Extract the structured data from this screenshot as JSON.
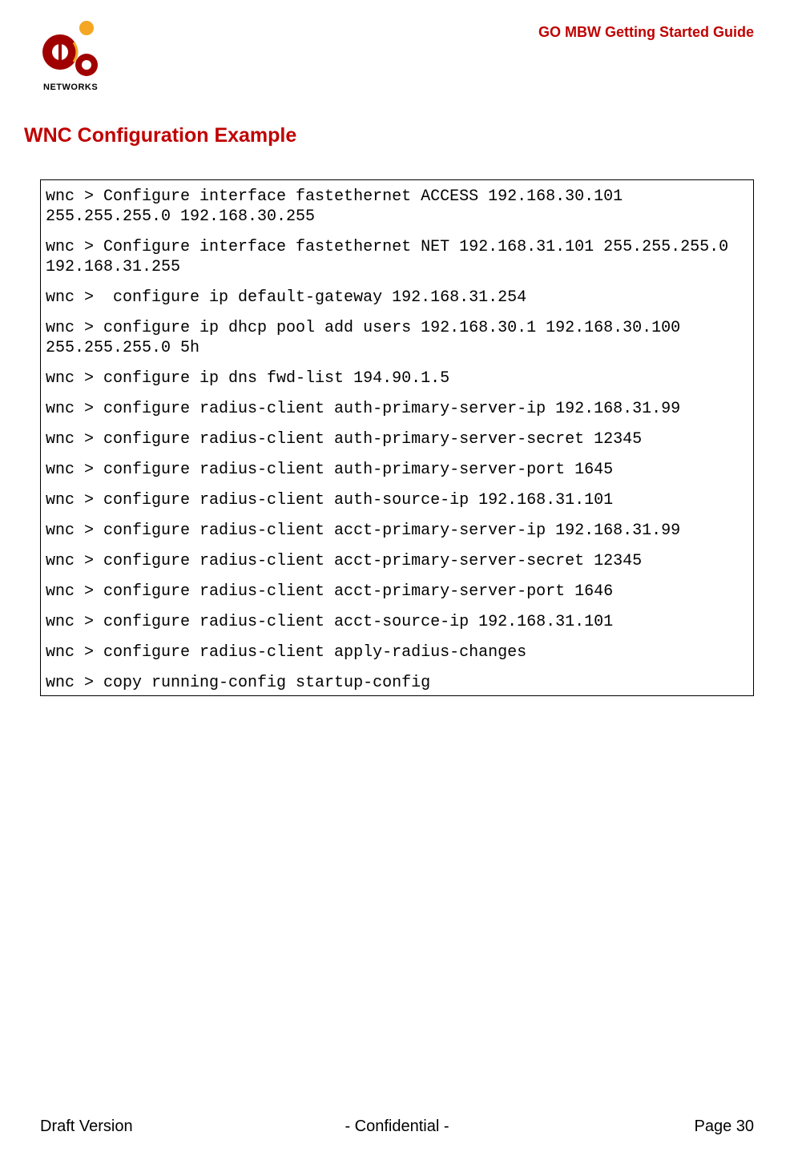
{
  "header": {
    "guide_title": "GO MBW Getting Started Guide",
    "logo_text": "NETWORKS"
  },
  "section_title": "WNC Configuration Example",
  "config_lines": [
    "wnc > Configure interface fastethernet ACCESS 192.168.30.101 255.255.255.0 192.168.30.255",
    "wnc > Configure interface fastethernet NET 192.168.31.101 255.255.255.0 192.168.31.255",
    "wnc >  configure ip default-gateway 192.168.31.254",
    "wnc > configure ip dhcp pool add users 192.168.30.1 192.168.30.100 255.255.255.0 5h",
    "wnc > configure ip dns fwd-list 194.90.1.5",
    "wnc > configure radius-client auth-primary-server-ip 192.168.31.99",
    "wnc > configure radius-client auth-primary-server-secret 12345",
    "wnc > configure radius-client auth-primary-server-port 1645",
    "wnc > configure radius-client auth-source-ip 192.168.31.101",
    "wnc > configure radius-client acct-primary-server-ip 192.168.31.99",
    "wnc > configure radius-client acct-primary-server-secret 12345",
    "wnc > configure radius-client acct-primary-server-port 1646",
    "wnc > configure radius-client acct-source-ip 192.168.31.101",
    "wnc > configure radius-client apply-radius-changes",
    "wnc > copy running-config startup-config"
  ],
  "footer": {
    "left": "Draft Version",
    "center": "-  Confidential  -",
    "right": "Page 30"
  }
}
